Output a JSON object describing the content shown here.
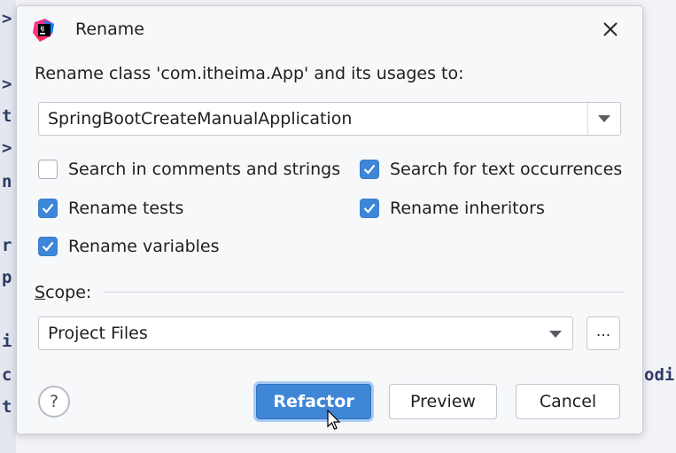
{
  "background": {
    "left_fragments": [
      ">",
      ">",
      "t",
      ">",
      "n",
      "r",
      "p",
      "i",
      "c",
      "t"
    ],
    "right_fragment": "odi"
  },
  "dialog": {
    "title": "Rename",
    "app_icon": "intellij-idea-icon",
    "close_icon": "close-icon",
    "prompt": "Rename class 'com.itheima.App' and its usages to:",
    "new_name": "SpringBootCreateManualApplication",
    "options": [
      {
        "label": "Search in comments and strings",
        "checked": false
      },
      {
        "label": "Search for text occurrences",
        "checked": true
      },
      {
        "label": "Rename tests",
        "checked": true
      },
      {
        "label": "Rename inheritors",
        "checked": true
      },
      {
        "label": "Rename variables",
        "checked": true
      }
    ],
    "scope": {
      "label_mnemonic": "S",
      "label_rest": "cope:",
      "value": "Project Files",
      "more_label": "..."
    },
    "buttons": {
      "help": "?",
      "refactor": "Refactor",
      "preview": "Preview",
      "cancel": "Cancel"
    },
    "accent_color": "#3d86d8"
  }
}
